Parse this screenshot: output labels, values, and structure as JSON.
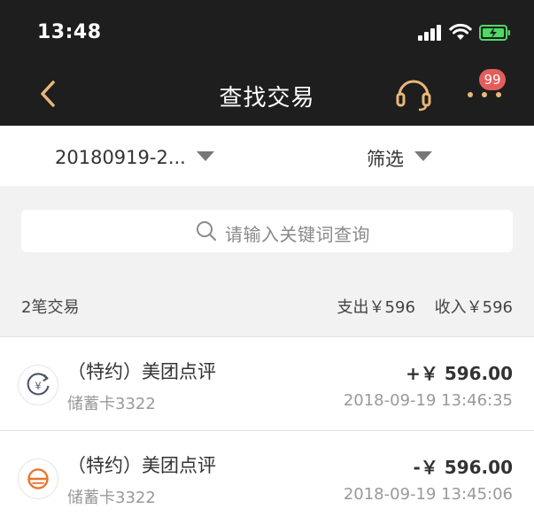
{
  "status_bar": {
    "time": "13:48"
  },
  "nav": {
    "title": "查找交易",
    "badge_count": "99"
  },
  "filter": {
    "date_range": "20180919-2...",
    "filter_label": "筛选"
  },
  "search": {
    "placeholder": "请输入关键词查询"
  },
  "summary": {
    "count": "2笔交易",
    "expense": "支出￥596",
    "income": "收入￥596"
  },
  "transactions": [
    {
      "name": "（特约）美团点评",
      "account": "储蓄卡3322",
      "amount": "+￥ 596.00",
      "time": "2018-09-19 13:46:35",
      "icon": "refund-yuan-icon"
    },
    {
      "name": "（特约）美团点评",
      "account": "储蓄卡3322",
      "amount": "-￥ 596.00",
      "time": "2018-09-19 13:45:06",
      "icon": "meituan-logo-icon"
    }
  ],
  "colors": {
    "accent": "#e8b87a",
    "badge": "#e45d5d",
    "battery": "#4cd964",
    "dark_bar": "#1e1e1e",
    "brand_orange": "#e8752f"
  }
}
